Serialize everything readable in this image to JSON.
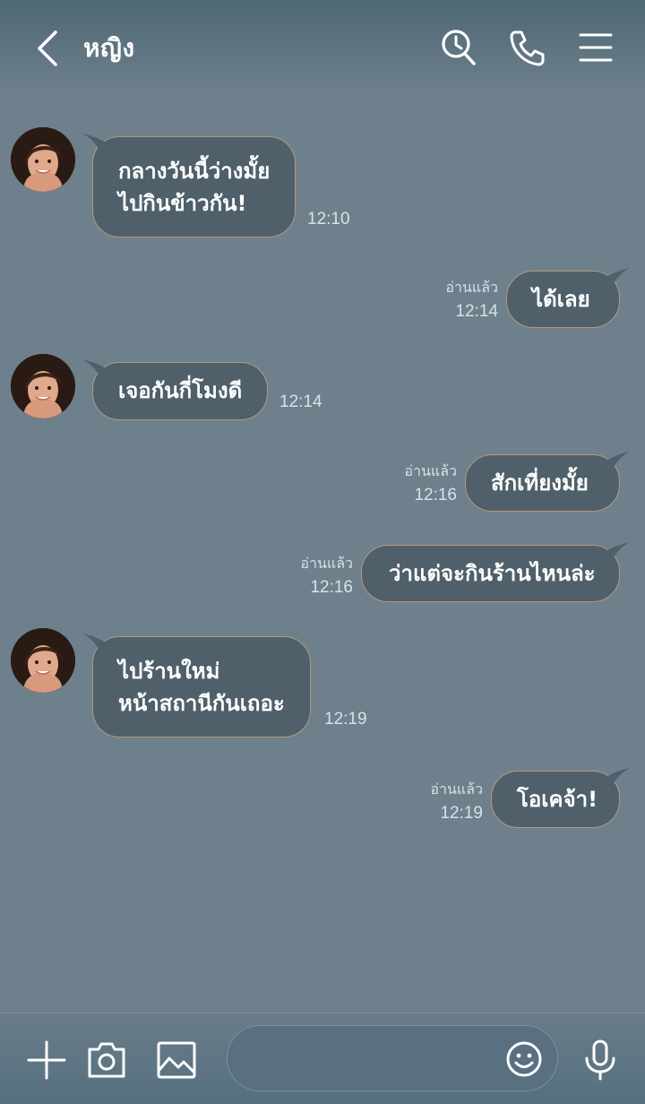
{
  "header": {
    "title": "หญิง",
    "icons": [
      "back-icon",
      "search-icon",
      "phone-icon",
      "menu-icon"
    ]
  },
  "messages": [
    {
      "side": "left",
      "lines": [
        "กลางวันนี้ว่างมั้ย",
        "ไปกินข้าวกัน!"
      ],
      "time": "12:10"
    },
    {
      "side": "right",
      "text": "ได้เลย",
      "read": "อ่านแล้ว",
      "time": "12:14"
    },
    {
      "side": "left",
      "text": "เจอกันกี่โมงดี",
      "time": "12:14"
    },
    {
      "side": "right",
      "text": "สักเที่ยงมั้ย",
      "read": "อ่านแล้ว",
      "time": "12:16"
    },
    {
      "side": "right",
      "text": "ว่าแต่จะกินร้านไหนล่ะ",
      "read": "อ่านแล้ว",
      "time": "12:16"
    },
    {
      "side": "left",
      "lines": [
        "ไปร้านใหม่",
        "หน้าสถานีกันเถอะ"
      ],
      "time": "12:19"
    },
    {
      "side": "right",
      "text": "โอเคจ้า!",
      "read": "อ่านแล้ว",
      "time": "12:19"
    }
  ],
  "footer": {
    "icons": [
      "plus-icon",
      "camera-icon",
      "image-icon",
      "emoji-icon",
      "microphone-icon"
    ],
    "input_value": "",
    "input_placeholder": ""
  },
  "colors": {
    "background": "#6e808c",
    "bubble": "#4f606b",
    "bubble_border": "#b29a7c",
    "text": "#ffffff",
    "meta_text": "#d9e1e6"
  }
}
